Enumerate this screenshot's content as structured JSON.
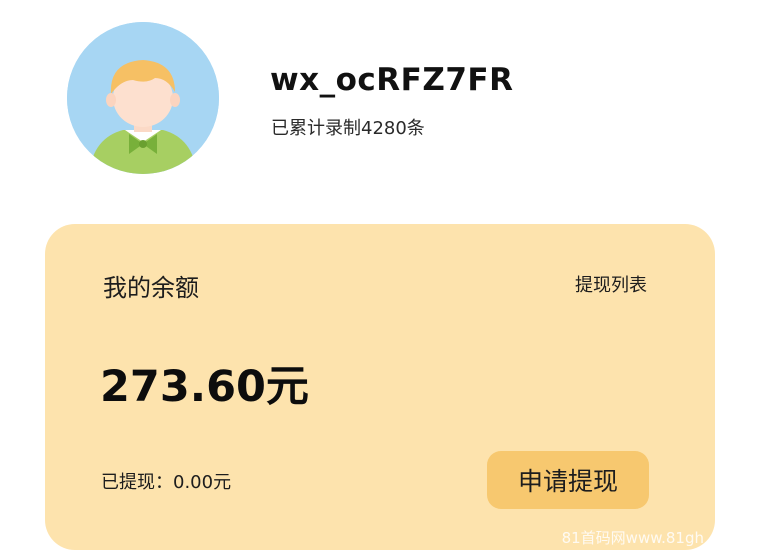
{
  "profile": {
    "username": "wx_ocRFZ7FR",
    "record_count": "已累计录制4280条",
    "avatar_icon": "boy-avatar-icon"
  },
  "balance_card": {
    "title": "我的余额",
    "withdraw_list_link": "提现列表",
    "amount": "273.60元",
    "withdrawn": "已提现：0.00元",
    "apply_button": "申请提现"
  },
  "watermark": "81首码网www.81gh",
  "colors": {
    "card_background": "#fde3ad",
    "button_background": "#f7c86f",
    "avatar_background": "#a7d6f3"
  }
}
